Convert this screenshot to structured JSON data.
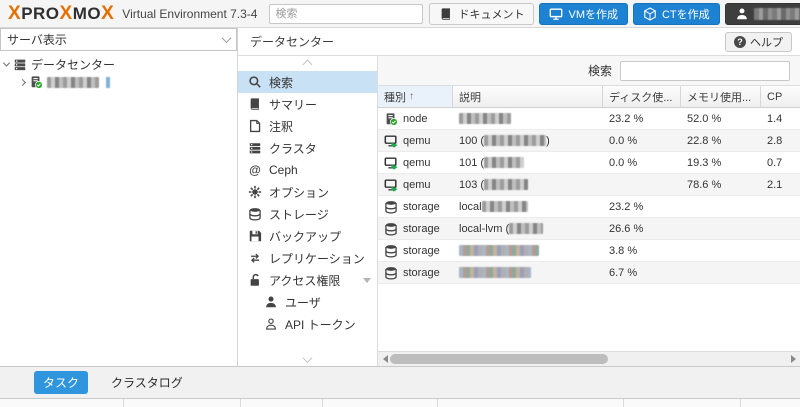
{
  "colors": {
    "brand_orange": "#E57000",
    "button_blue": "#1d82d2",
    "selected_item": "#c9e1f5",
    "tab_selected": "#2f96dd"
  },
  "header": {
    "brand_x1": "X",
    "brand_p1": "PRO",
    "brand_x2": "X",
    "brand_p2": "MO",
    "brand_x3": "X",
    "subtitle": "Virtual Environment 7.3-4",
    "search_placeholder": "検索",
    "docs_label": "ドキュメント",
    "create_vm_label": "VMを作成",
    "create_ct_label": "CTを作成"
  },
  "sidebar": {
    "view_selector": "サーバ表示",
    "root_node": "データセンター"
  },
  "panel": {
    "title": "データセンター",
    "help_label": "ヘルプ",
    "menu": [
      {
        "label": "検索",
        "icon": "search",
        "selected": true
      },
      {
        "label": "サマリー",
        "icon": "book"
      },
      {
        "label": "注釈",
        "icon": "note"
      },
      {
        "label": "クラスタ",
        "icon": "cluster"
      },
      {
        "label": "Ceph",
        "icon": "ceph"
      },
      {
        "label": "オプション",
        "icon": "gear"
      },
      {
        "label": "ストレージ",
        "icon": "storage"
      },
      {
        "label": "バックアップ",
        "icon": "backup"
      },
      {
        "label": "レプリケーション",
        "icon": "replication"
      },
      {
        "label": "アクセス権限",
        "icon": "unlock",
        "group": true
      },
      {
        "label": "ユーザ",
        "icon": "user",
        "indent": true
      },
      {
        "label": "API トークン",
        "icon": "user-outline",
        "indent": true
      }
    ]
  },
  "table": {
    "search_label": "検索",
    "columns": [
      {
        "label": "種別",
        "sorted": "asc"
      },
      {
        "label": "説明"
      },
      {
        "label": "ディスク使..."
      },
      {
        "label": "メモリ使用..."
      },
      {
        "label": "CP"
      }
    ],
    "rows": [
      {
        "type": "node",
        "icon": "node",
        "desc": "",
        "redacted": 52,
        "variant": "gray",
        "suffix": "",
        "disk": "23.2 %",
        "mem": "52.0 %",
        "cpu": "1.4"
      },
      {
        "type": "qemu",
        "icon": "qemu",
        "desc": "100 (",
        "redacted": 62,
        "variant": "gray",
        "suffix": ")",
        "disk": "0.0 %",
        "mem": "22.8 %",
        "cpu": "2.8"
      },
      {
        "type": "qemu",
        "icon": "qemu",
        "desc": "101 (",
        "redacted": 40,
        "variant": "gray",
        "suffix": "",
        "disk": "0.0 %",
        "mem": "19.3 %",
        "cpu": "0.7"
      },
      {
        "type": "qemu",
        "icon": "qemu",
        "desc": "103 (",
        "redacted": 44,
        "variant": "gray",
        "suffix": "",
        "disk": "",
        "mem": "78.6 %",
        "cpu": "2.1"
      },
      {
        "type": "storage",
        "icon": "storage",
        "desc": "local ",
        "redacted": 46,
        "variant": "gray",
        "suffix": "",
        "disk": "23.2 %",
        "mem": "",
        "cpu": ""
      },
      {
        "type": "storage",
        "icon": "storage",
        "desc": "local-lvm (",
        "redacted": 34,
        "variant": "gray",
        "suffix": "",
        "disk": "26.6 %",
        "mem": "",
        "cpu": ""
      },
      {
        "type": "storage",
        "icon": "storage",
        "desc": "",
        "redacted": 80,
        "variant": "color",
        "suffix": "",
        "disk": "3.8 %",
        "mem": "",
        "cpu": ""
      },
      {
        "type": "storage",
        "icon": "storage",
        "desc": "",
        "redacted": 72,
        "variant": "color",
        "suffix": "",
        "disk": "6.7 %",
        "mem": "",
        "cpu": ""
      }
    ]
  },
  "statusbar": {
    "tasks_label": "タスク",
    "clusterlog_label": "クラスタログ"
  }
}
